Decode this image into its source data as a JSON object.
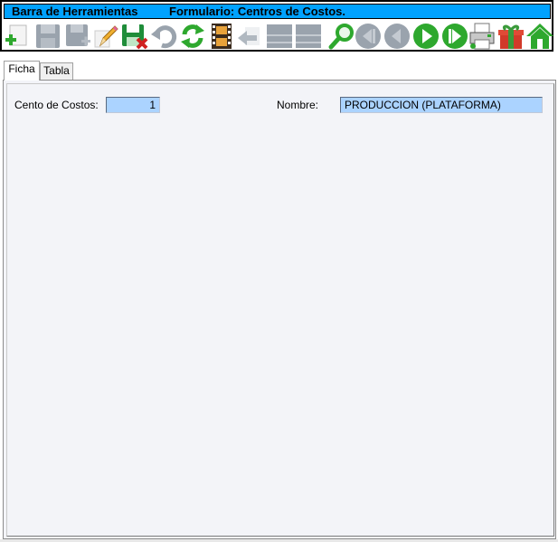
{
  "title_bar": {
    "toolbar_name": "Barra de Herramientas",
    "form_title": "Formulario: Centros de Costos."
  },
  "toolbar": {
    "icons": [
      "add-record-icon",
      "save-disabled-icon",
      "save-new-disabled-icon",
      "edit-pencil-icon",
      "delete-save-icon",
      "undo-disabled-icon",
      "refresh-icon",
      "film-icon",
      "return-disabled-icon",
      "table-disabled-icon",
      "table-disabled-icon-2",
      "search-magnifier-icon",
      "first-record-disabled-icon",
      "previous-record-disabled-icon",
      "next-record-icon",
      "last-record-icon",
      "printer-icon",
      "gift-icon",
      "home-icon"
    ],
    "colors": {
      "green": "#2ea82e",
      "disabled": "#9aa3ad"
    }
  },
  "tabs": [
    {
      "label": "Ficha",
      "active": true
    },
    {
      "label": "Tabla",
      "active": false
    }
  ],
  "form": {
    "cost_center_label": "Cento de Costos:",
    "cost_center_value": "1",
    "name_label": "Nombre:",
    "name_value": "PRODUCCION (PLATAFORMA)"
  },
  "colors": {
    "title_bar": "#00a2ff",
    "field_bg": "#abd3ff",
    "panel_bg": "#f3f4f8"
  }
}
